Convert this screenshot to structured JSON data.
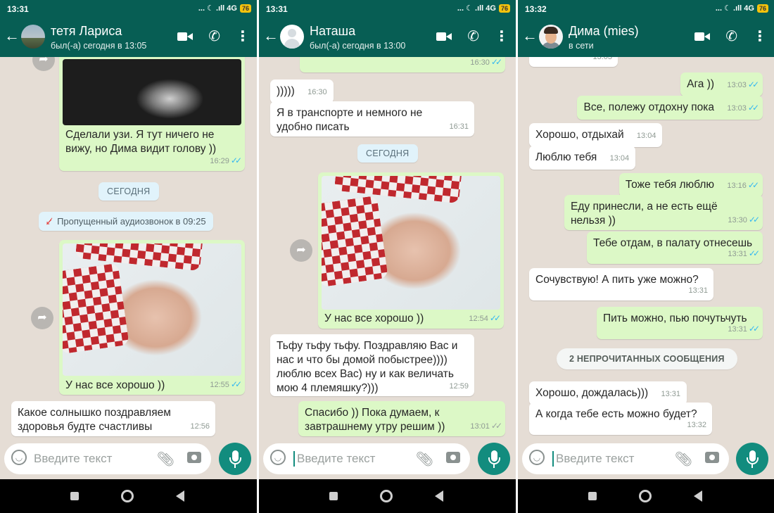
{
  "statusbar": {
    "panel1_time": "13:31",
    "panel2_time": "13:31",
    "panel3_time": "13:32",
    "indicators": "... ☾ .ıll 4G",
    "battery": "76"
  },
  "colors": {
    "header": "#075e54",
    "accent": "#128c7e",
    "outgoing_bubble": "#dcf8c6",
    "incoming_bubble": "#ffffff",
    "chat_bg": "#e5ddd5",
    "read_ticks": "#34b7f1"
  },
  "icons": [
    "back-arrow-icon",
    "video-call-icon",
    "voice-call-icon",
    "more-options-icon",
    "forward-icon",
    "missed-call-icon",
    "emoji-icon",
    "attach-icon",
    "camera-icon",
    "mic-icon",
    "nav-recents-icon",
    "nav-home-icon",
    "nav-back-icon"
  ],
  "composer_placeholder": "Введите текст",
  "panels": [
    {
      "contact_name": "тетя Лариса",
      "status": "был(-а) сегодня в 13:05",
      "messages": [
        {
          "text": "Сделали узи. Я тут ничего не вижу, но Дима видит голову ))",
          "time": "16:29"
        },
        {
          "text": "У нас все хорошо ))",
          "time": "12:55"
        },
        {
          "text": "Какое солнышко  поздравляем здоровья будте счастливы",
          "time": "12:56"
        }
      ],
      "date_chip": "СЕГОДНЯ",
      "missed_call": "Пропущенный аудиозвонок в 09:25"
    },
    {
      "contact_name": "Наташа",
      "status": "был(-а) сегодня в 13:00",
      "messages": [
        {
          "text": "",
          "time": "16:30"
        },
        {
          "text": ")))))",
          "time": "16:30"
        },
        {
          "text": "Я в транспорте и немного не удобно писать",
          "time": "16:31"
        },
        {
          "text": "У нас все хорошо ))",
          "time": "12:54"
        },
        {
          "text": "Тьфу тьфу тьфу. Поздравляю Вас и нас и что бы домой побыстрее)))) люблю всех Вас) ну и как величать мою 4 племяшку?)))",
          "time": "12:59"
        },
        {
          "text": "Спасибо )) Пока думаем, к завтрашнему утру решим ))",
          "time": "13:01"
        }
      ],
      "date_chip": "СЕГОДНЯ"
    },
    {
      "contact_name": "Дима (mies)",
      "status": "в сети",
      "messages": [
        {
          "text": "",
          "time": "13:03"
        },
        {
          "text": "Ага ))",
          "time": "13:03"
        },
        {
          "text": "Все, полежу отдохну пока",
          "time": "13:03"
        },
        {
          "text": "Хорошо, отдыхай",
          "time": "13:04"
        },
        {
          "text": "Люблю тебя",
          "time": "13:04"
        },
        {
          "text": "Тоже тебя люблю",
          "time": "13:16"
        },
        {
          "text": "Еду принесли, а не есть ещё нельзя ))",
          "time": "13:30"
        },
        {
          "text": "Тебе отдам, в палату отнесешь",
          "time": "13:31"
        },
        {
          "text": "Сочувствую! А пить уже можно?",
          "time": "13:31"
        },
        {
          "text": "Пить можно, пью почутьчуть",
          "time": "13:31"
        },
        {
          "text": "Хорошо, дождалась)))",
          "time": "13:31"
        },
        {
          "text": "А когда тебе есть можно будет?",
          "time": "13:32"
        }
      ],
      "unread_chip": "2 НЕПРОЧИТАННЫХ СООБЩЕНИЯ"
    }
  ]
}
